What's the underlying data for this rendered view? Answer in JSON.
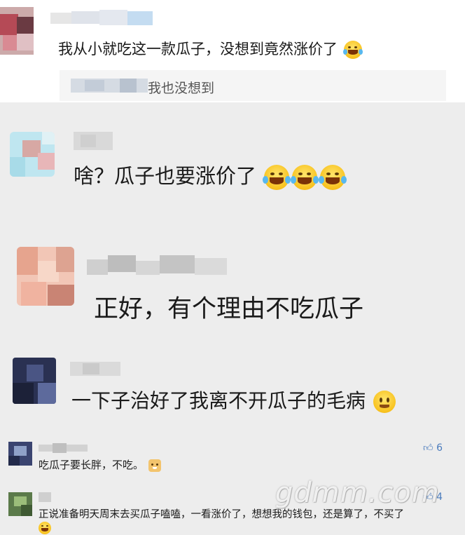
{
  "comments": [
    {
      "text": "我从小就吃这一款瓜子，没想到竟然涨价了",
      "reply_text": "我也没想到"
    },
    {
      "text": "啥？瓜子也要涨价了"
    },
    {
      "text": "正好，有个理由不吃瓜子"
    },
    {
      "text": "一下子治好了我离不开瓜子的毛病"
    },
    {
      "text": "吃瓜子要长胖，不吃。",
      "likes": "6"
    },
    {
      "text_line1": "正说准备明天周末去买瓜子嗑嗑，一看涨价了，想想我的钱包，还是算了，不买了",
      "likes": "4"
    }
  ],
  "watermark": "gdmm.com",
  "colors": {
    "panel": "#ededed",
    "like": "#4a7bbd"
  }
}
